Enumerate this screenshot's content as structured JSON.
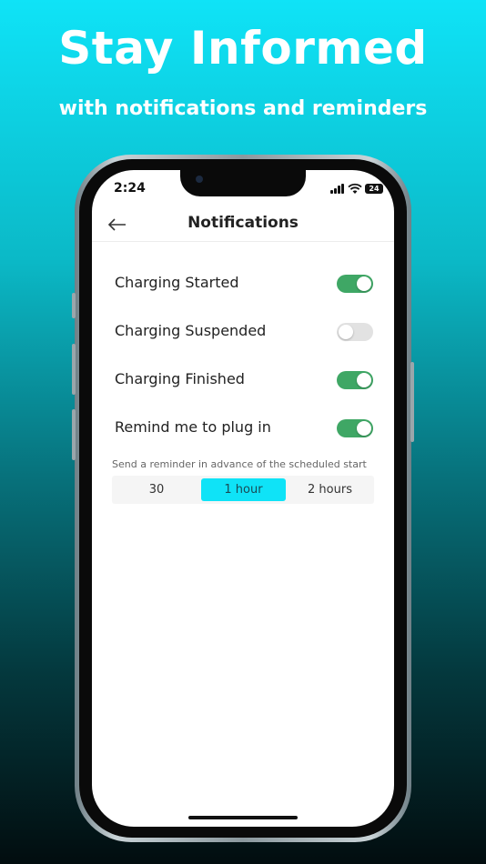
{
  "promo": {
    "headline": "Stay Informed",
    "subline": "with notifications and reminders"
  },
  "status_bar": {
    "time": "2:24",
    "battery": "24"
  },
  "header": {
    "title": "Notifications",
    "back_icon": "arrow-left-icon"
  },
  "settings": [
    {
      "label": "Charging Started",
      "enabled": true
    },
    {
      "label": "Charging Suspended",
      "enabled": false
    },
    {
      "label": "Charging Finished",
      "enabled": true
    },
    {
      "label": "Remind me to plug in",
      "enabled": true
    }
  ],
  "reminder": {
    "helper_text": "Send a reminder in advance of the scheduled start",
    "options": [
      "30",
      "1 hour",
      "2 hours"
    ],
    "selected": "1 hour"
  },
  "colors": {
    "toggle_on": "#3fa765",
    "toggle_off": "#e2e2e2",
    "accent": "#0fe3f7"
  }
}
